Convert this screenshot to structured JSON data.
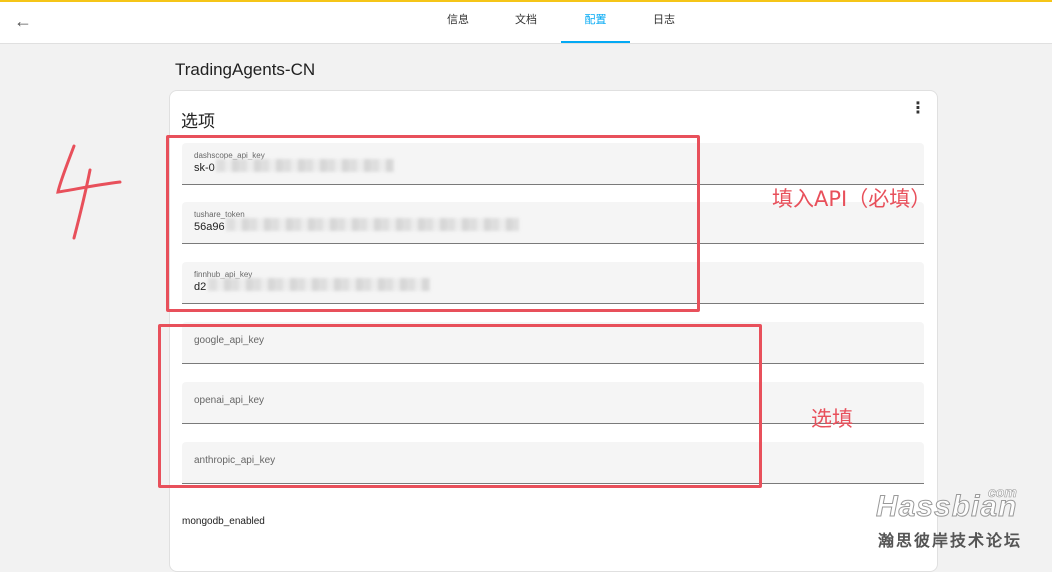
{
  "header": {
    "back_icon": "arrow-left-icon",
    "tabs": [
      {
        "label": "信息",
        "active": false
      },
      {
        "label": "文档",
        "active": false
      },
      {
        "label": "配置",
        "active": true
      },
      {
        "label": "日志",
        "active": false
      }
    ],
    "accent_color": "#03a9f4"
  },
  "page": {
    "addon_title": "TradingAgents-CN",
    "card_title": "选项",
    "more_icon": "more-vertical-icon"
  },
  "fields": [
    {
      "label": "dashscope_api_key",
      "value": "sk-0",
      "blurred": true
    },
    {
      "label": "tushare_token",
      "value": "56a96",
      "blurred": true
    },
    {
      "label": "finnhub_api_key",
      "value": "d2",
      "blurred": true
    },
    {
      "label": "google_api_key",
      "value": ""
    },
    {
      "label": "openai_api_key",
      "value": ""
    },
    {
      "label": "anthropic_api_key",
      "value": ""
    }
  ],
  "toggle": {
    "label": "mongodb_enabled"
  },
  "annotations": {
    "step_number": "4",
    "required_note": "填入API（必填）",
    "optional_note": "选填",
    "color": "#e8505b"
  },
  "watermark": {
    "brand": "Hassbian",
    "domain": "com",
    "forum": "瀚思彼岸技术论坛"
  }
}
